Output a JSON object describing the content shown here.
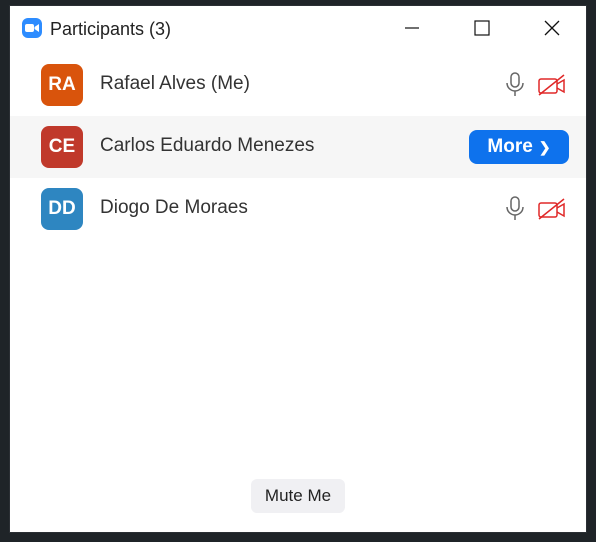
{
  "window": {
    "title": "Participants (3)"
  },
  "participants": [
    {
      "initials": "RA",
      "name": "Rafael Alves (Me)",
      "avatar_color": "#d9540c",
      "mic_icon": "microphone-icon",
      "video_icon": "video-off-icon"
    },
    {
      "initials": "CE",
      "name": "Carlos Eduardo Menezes",
      "avatar_color": "#c0392b",
      "more_label": "More"
    },
    {
      "initials": "DD",
      "name": "Diogo De Moraes",
      "avatar_color": "#2e86c1",
      "mic_icon": "microphone-icon",
      "video_icon": "video-off-icon"
    }
  ],
  "footer": {
    "mute_label": "Mute Me"
  },
  "colors": {
    "accent": "#0e72ed",
    "video_off": "#e02828"
  }
}
